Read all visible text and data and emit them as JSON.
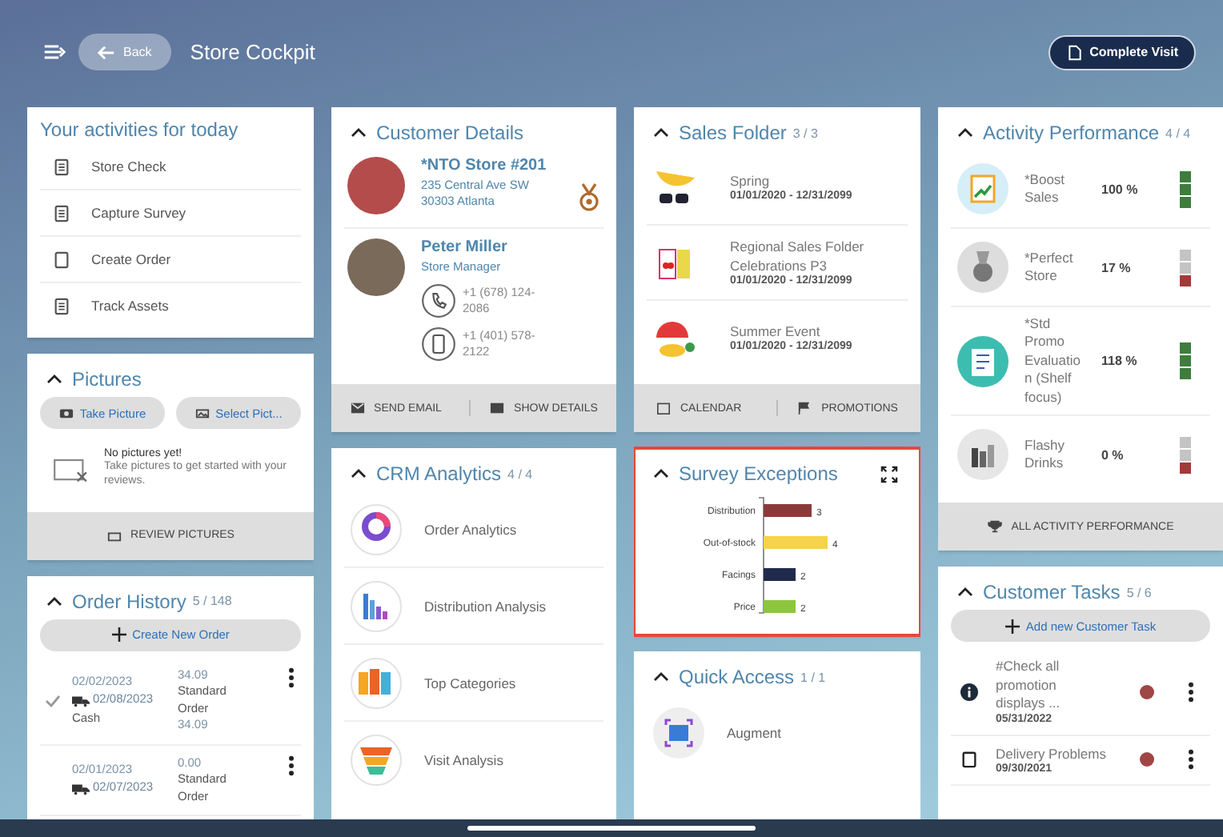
{
  "header": {
    "back": "Back",
    "title": "Store Cockpit",
    "complete": "Complete Visit"
  },
  "activities": {
    "title": "Your activities for today",
    "items": [
      {
        "label": "Store Check"
      },
      {
        "label": "Capture Survey"
      },
      {
        "label": "Create Order"
      },
      {
        "label": "Track Assets"
      }
    ]
  },
  "pictures": {
    "title": "Pictures",
    "take": "Take Picture",
    "select": "Select Pict...",
    "empty_title": "No pictures yet!",
    "empty_text": "Take pictures to get started with your reviews.",
    "footer": "REVIEW PICTURES"
  },
  "order_history": {
    "title": "Order History",
    "count": "5 / 148",
    "create": "Create New Order",
    "orders": [
      {
        "done": true,
        "date": "02/02/2023",
        "delivery": "02/08/2023",
        "payment": "Cash",
        "amount": "34.09",
        "type": "Standard Order",
        "total": "34.09"
      },
      {
        "done": false,
        "date": "02/01/2023",
        "delivery": "02/07/2023",
        "amount": "0.00",
        "type": "Standard Order"
      }
    ]
  },
  "customer": {
    "title": "Customer Details",
    "store": {
      "name": "*NTO Store #201",
      "address_1": "235 Central Ave SW",
      "address_2": "30303 Atlanta"
    },
    "contact": {
      "name": "Peter Miller",
      "role": "Store Manager",
      "phone": "+1 (678) 124-2086",
      "mobile": "+1 (401) 578-2122"
    },
    "actions": [
      "SEND EMAIL",
      "SHOW DETAILS"
    ]
  },
  "crm": {
    "title": "CRM Analytics",
    "count": "4 / 4",
    "items": [
      {
        "label": "Order Analytics"
      },
      {
        "label": "Distribution Analysis"
      },
      {
        "label": "Top Categories"
      },
      {
        "label": "Visit Analysis"
      }
    ]
  },
  "sales_folder": {
    "title": "Sales Folder",
    "count": "3 / 3",
    "items": [
      {
        "name": "Spring",
        "dates": "01/01/2020 - 12/31/2099"
      },
      {
        "name": "Regional Sales Folder Celebrations P3",
        "dates": "01/01/2020 - 12/31/2099"
      },
      {
        "name": "Summer Event",
        "dates": "01/01/2020 - 12/31/2099"
      }
    ],
    "actions": [
      "CALENDAR",
      "PROMOTIONS"
    ]
  },
  "survey": {
    "title": "Survey Exceptions",
    "chart_data": {
      "type": "bar",
      "orientation": "horizontal",
      "categories": [
        "Distribution",
        "Out-of-stock",
        "Facings",
        "Price"
      ],
      "series": [
        {
          "values": [
            3,
            4,
            2,
            2
          ]
        }
      ],
      "colors": [
        "#8b3a3a",
        "#f5d34a",
        "#1f2a4d",
        "#8cc63f"
      ],
      "data_labels": true
    }
  },
  "quick_access": {
    "title": "Quick Access",
    "count": "1 / 1",
    "items": [
      {
        "label": "Augment"
      }
    ]
  },
  "activity_performance": {
    "title": "Activity Performance",
    "count": "4 / 4",
    "items": [
      {
        "name": "*Boost Sales",
        "percent": "100 %",
        "indicators": [
          {
            "color": "#3e7d3e"
          },
          {
            "color": "#3e7d3e"
          },
          {
            "color": "#3e7d3e"
          }
        ]
      },
      {
        "name": "*Perfect Store",
        "percent": "17 %",
        "indicators": [
          {
            "color": "#c4c4c4"
          },
          {
            "color": "#c4c4c4"
          },
          {
            "color": "#a33a3a"
          }
        ]
      },
      {
        "name": "*Std Promo Evaluation (Shelf focus)",
        "percent": "118 %",
        "indicators": [
          {
            "color": "#3e7d3e"
          },
          {
            "color": "#3e7d3e"
          },
          {
            "color": "#3e7d3e"
          }
        ]
      },
      {
        "name": "Flashy Drinks",
        "percent": "0 %",
        "indicators": [
          {
            "color": "#c4c4c4"
          },
          {
            "color": "#c4c4c4"
          },
          {
            "color": "#a33a3a"
          }
        ]
      }
    ],
    "footer": "ALL ACTIVITY PERFORMANCE"
  },
  "customer_tasks": {
    "title": "Customer Tasks",
    "count": "5 / 6",
    "add": "Add new Customer Task",
    "tasks": [
      {
        "kind": "info",
        "title": "#Check all promotion displays ...",
        "date": "05/31/2022",
        "color": "#a04545"
      },
      {
        "kind": "task",
        "title": "Delivery Problems",
        "date": "09/30/2021",
        "color": "#a04545"
      }
    ]
  }
}
